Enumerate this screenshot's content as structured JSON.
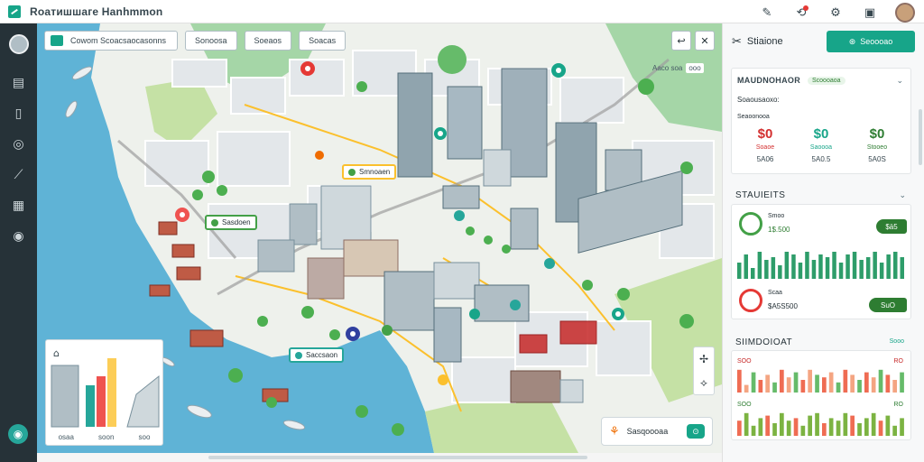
{
  "app": {
    "title": "Rоатишшаге Hanhmmon"
  },
  "topbar": {
    "icons": [
      "pen-icon",
      "notification-icon",
      "settings-icon",
      "window-icon"
    ]
  },
  "rail": {
    "items": [
      "clipboard-icon",
      "document-icon",
      "compass-icon",
      "route-icon",
      "grid-icon",
      "globe-icon"
    ]
  },
  "map": {
    "search_text": "Cowom Scoacsaocasonns",
    "chips": [
      "Sonoosa",
      "Soeaos",
      "Soacas"
    ],
    "labels": [
      {
        "text": "Smnoaen",
        "style": "orange"
      },
      {
        "text": "Sasdoen",
        "style": "green"
      },
      {
        "text": "Saccsaon",
        "style": "blue"
      }
    ],
    "count_tag": {
      "label": "Aaco soa",
      "value": "ooo"
    },
    "mini_panel_footer": [
      "osaa",
      "soon",
      "soo"
    ],
    "route_card_text": "Sasqoooaa",
    "route_card_go": "⊙",
    "colors": {
      "water": "#5fb3d6",
      "park": "#a5d6a7",
      "road": "#ffffff",
      "block": "#e6e9ec",
      "accent": "#17a589"
    }
  },
  "panel": {
    "header_label": "Stiaione",
    "primary_button": "Seoooao",
    "summary": {
      "title": "MAUDNOHAOR",
      "pill": "Scoooaoa",
      "subtitle": "Soaousaoxo:",
      "sub2": "Seaoonooa",
      "stats": [
        {
          "icon": "$0",
          "label": "Soaoe",
          "value": "5A06",
          "color": "#d32f2f"
        },
        {
          "icon": "$0",
          "label": "Saoooa",
          "value": "5A0.5",
          "color": "#17a589"
        },
        {
          "icon": "$0",
          "label": "Stooeo",
          "value": "5A0S",
          "color": "#2e7d32"
        }
      ]
    },
    "statistics": {
      "title": "STAUIEITS",
      "rows": [
        {
          "name": "Smoo",
          "value": "1$.500",
          "badge": "$ä5",
          "ring": "#43a047"
        },
        {
          "name": "Scaa",
          "value": "$A5S500",
          "badge": "SuO",
          "ring": "#e53935"
        }
      ],
      "bars_row1": [
        6,
        9,
        4,
        10,
        7,
        8,
        5,
        10,
        9,
        6,
        10,
        7,
        9,
        8,
        10,
        6,
        9,
        10,
        7,
        8,
        10,
        6,
        9,
        10,
        8
      ],
      "bars_row2": []
    },
    "standouts": {
      "title": "SIIMDOIOAT",
      "link": "Sooo",
      "rows": [
        {
          "label": "SOO",
          "value": "RO"
        },
        {
          "label": "SOO",
          "value": "RO"
        }
      ],
      "bars_a": [
        0.9,
        0.3,
        0.8,
        0.5,
        0.7,
        0.4,
        0.9,
        0.6,
        0.8,
        0.5,
        0.9,
        0.7,
        0.6,
        0.8,
        0.4,
        0.9,
        0.7,
        0.5,
        0.8,
        0.6,
        0.9,
        0.7,
        0.5,
        0.8
      ],
      "bars_b": [
        0.6,
        0.9,
        0.4,
        0.7,
        0.8,
        0.5,
        0.9,
        0.6,
        0.7,
        0.4,
        0.8,
        0.9,
        0.5,
        0.7,
        0.6,
        0.9,
        0.8,
        0.5,
        0.7,
        0.9,
        0.6,
        0.8,
        0.4,
        0.7
      ]
    }
  }
}
